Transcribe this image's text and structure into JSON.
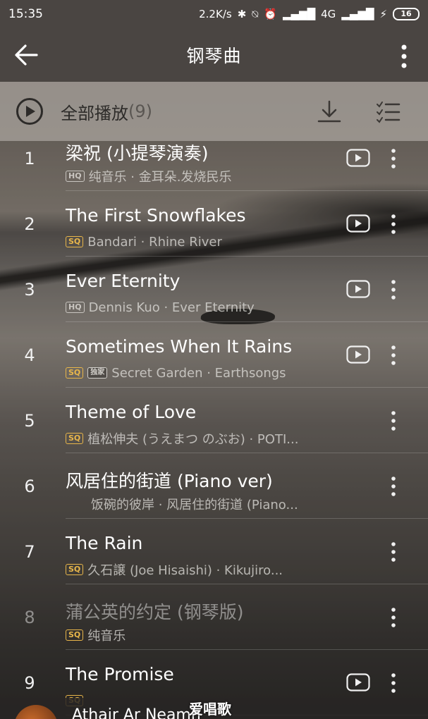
{
  "status_bar": {
    "time": "15:35",
    "net_speed": "2.2K/s",
    "network": "4G",
    "battery": "16"
  },
  "app_bar": {
    "title": "钢琴曲"
  },
  "play_all": {
    "label": "全部播放",
    "count": "(9)"
  },
  "songs": [
    {
      "index": "1",
      "title": "梁祝 (小提琴演奏)",
      "quality": "HQ",
      "exclusive": false,
      "subtitle": "纯音乐 · 金耳朵.发烧民乐",
      "has_video": true,
      "disabled": false
    },
    {
      "index": "2",
      "title": "The First Snowflakes",
      "quality": "SQ",
      "exclusive": false,
      "subtitle": "Bandari · Rhine River",
      "has_video": true,
      "disabled": false
    },
    {
      "index": "3",
      "title": "Ever Eternity",
      "quality": "HQ",
      "exclusive": false,
      "subtitle": "Dennis Kuo · Ever Eternity",
      "has_video": true,
      "disabled": false
    },
    {
      "index": "4",
      "title": "Sometimes When It Rains",
      "quality": "SQ",
      "exclusive": true,
      "exclusive_label": "独家",
      "subtitle": "Secret Garden · Earthsongs",
      "has_video": true,
      "disabled": false
    },
    {
      "index": "5",
      "title": "Theme of Love",
      "quality": "SQ",
      "exclusive": false,
      "subtitle": "植松伸夫 (うえまつ のぶお) · POTI...",
      "has_video": false,
      "disabled": false
    },
    {
      "index": "6",
      "title": "风居住的街道 (Piano ver)",
      "quality": "",
      "exclusive": false,
      "subtitle": "饭碗的彼岸 · 风居住的街道 (Piano...",
      "has_video": false,
      "disabled": false
    },
    {
      "index": "7",
      "title": "The Rain",
      "quality": "SQ",
      "exclusive": false,
      "subtitle": "久石譲 (Joe Hisaishi) · Kikujiro...",
      "has_video": false,
      "disabled": false
    },
    {
      "index": "8",
      "title": "蒲公英的约定 (钢琴版)",
      "quality": "SQ",
      "exclusive": false,
      "subtitle": "纯音乐",
      "has_video": false,
      "disabled": true
    },
    {
      "index": "9",
      "title": "The Promise",
      "quality": "SQ",
      "exclusive": false,
      "subtitle": "",
      "has_video": true,
      "disabled": false
    }
  ],
  "mini_player": {
    "title": "Athair Ar Neamh"
  },
  "watermark": "爱唱歌",
  "colors": {
    "app_bar": "#4a4542",
    "sq_tag": "#e8b64a",
    "hq_tag": "#c9c5c0"
  },
  "icons": {
    "back": "arrow-left-icon",
    "more": "more-vertical-icon",
    "play_all": "play-circle-icon",
    "download": "download-icon",
    "manage": "list-check-icon",
    "video": "video-play-icon"
  }
}
